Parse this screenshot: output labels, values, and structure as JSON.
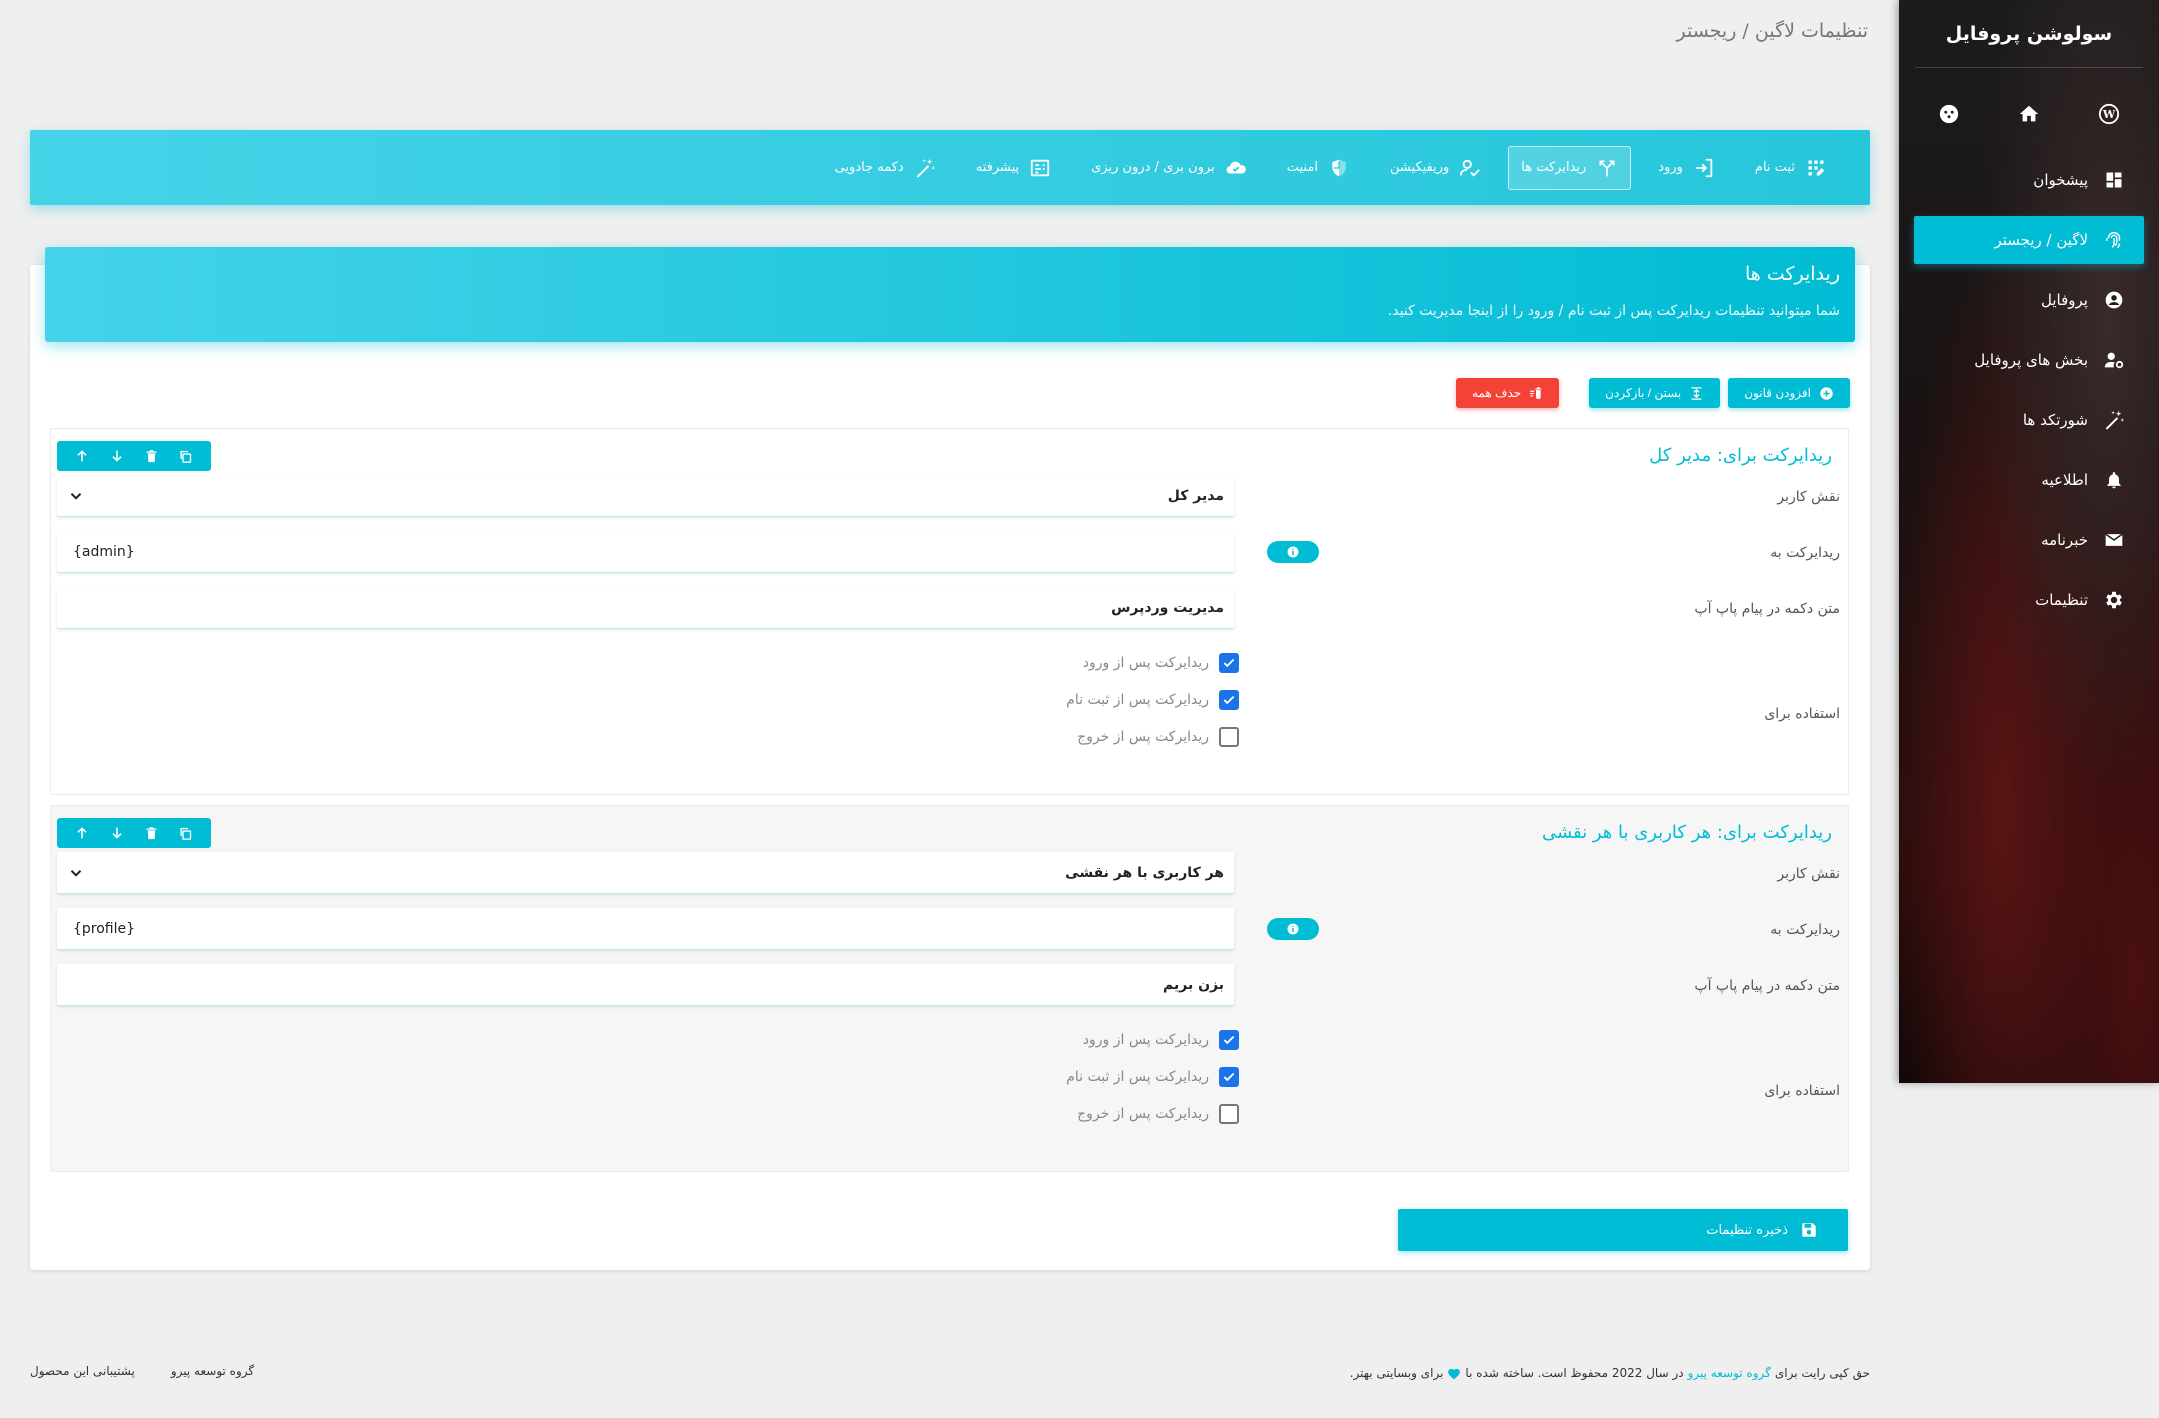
{
  "breadcrumb": "تنظیمات لاگین / ریجستر",
  "sidebar": {
    "brand": "سولوشن پروفایل",
    "quick_icons": [
      "wordpress-icon",
      "home-icon",
      "support-icon"
    ],
    "items": [
      {
        "label": "پیشخوان",
        "icon": "dashboard-icon"
      },
      {
        "label": "لاگین / ریجستر",
        "icon": "fingerprint-icon"
      },
      {
        "label": "پروفایل",
        "icon": "account-circle-icon"
      },
      {
        "label": "بخش های پروفایل",
        "icon": "user-settings-icon"
      },
      {
        "label": "شورتکد ها",
        "icon": "magic-wand-icon"
      },
      {
        "label": "اطلاعیه",
        "icon": "bell-icon"
      },
      {
        "label": "خبرنامه",
        "icon": "mail-icon"
      },
      {
        "label": "تنظیمات",
        "icon": "gear-icon"
      }
    ]
  },
  "tabs": [
    {
      "label": "ثبت نام",
      "icon": "register-icon"
    },
    {
      "label": "ورود",
      "icon": "login-icon"
    },
    {
      "label": "ریدایرکت ها",
      "icon": "redirect-icon"
    },
    {
      "label": "وریفیکیشن",
      "icon": "verify-user-icon"
    },
    {
      "label": "امنیت",
      "icon": "shield-icon"
    },
    {
      "label": "برون بری / درون ریزی",
      "icon": "cloud-icon"
    },
    {
      "label": "پیشرفته",
      "icon": "advanced-icon"
    },
    {
      "label": "دکمه جادویی",
      "icon": "magic-wand-icon"
    }
  ],
  "section": {
    "title": "ریدایرکت ها",
    "description": "شما میتوانید تنظیمات ریدایرکت پس از ثبت نام / ورود را از اینجا مدیریت کنید."
  },
  "actions": {
    "add_rule": "افزودن قانون",
    "collapse": "بستن / بازکردن",
    "delete_all": "حذف همه"
  },
  "labels": {
    "user_role": "نقش کاربر",
    "redirect_to": "ریدایرکت به",
    "popup_button_text": "متن دکمه در پیام پاپ آپ",
    "use_for": "استفاده برای",
    "after_login": "ریدایرکت پس از ورود",
    "after_register": "ریدایرکت پس از ثبت نام",
    "after_logout": "ریدایرکت پس از خروج"
  },
  "rules": [
    {
      "title": "ریدایرکت برای: مدیر کل",
      "role": "مدیر کل",
      "redirect": "{admin}",
      "button_text": "مدیریت وردپرس",
      "after_login": true,
      "after_register": true,
      "after_logout": false
    },
    {
      "title": "ریدایرکت برای: هر کاربری با هر نقشی",
      "role": "هر کاربری با هر نقشی",
      "redirect": "{profile}",
      "button_text": "بزن بریم",
      "after_login": true,
      "after_register": true,
      "after_logout": false
    }
  ],
  "save_label": "ذخیره تنظیمات",
  "footer": {
    "copyright_prefix": "حق کپی رایت برای",
    "copyright_link": "گروه توسعه پیرو",
    "copyright_suffix": "در سال 2022 محفوظ است. ساخته شده با",
    "copyright_end": "برای وبسایتی بهتر.",
    "link_group": "گروه توسعه پیرو",
    "link_support": "پشتیبانی این محصول"
  },
  "colors": {
    "accent": "#00bcd4",
    "danger": "#f44336",
    "checkbox": "#1a73e8"
  }
}
